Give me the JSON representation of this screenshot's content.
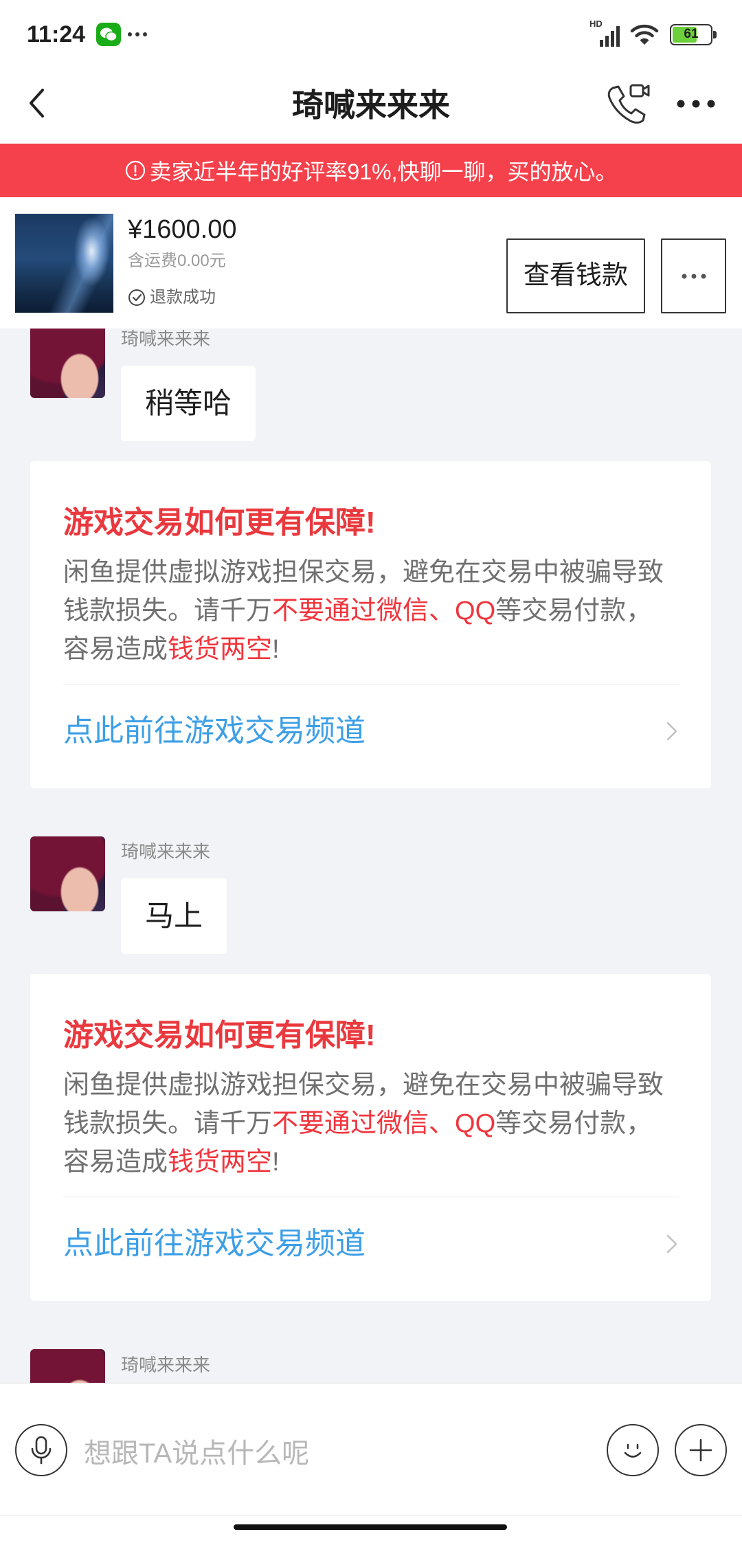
{
  "status_bar": {
    "time": "11:24",
    "network_label": "HD",
    "battery_level": "61",
    "icons": [
      "wechat-icon",
      "more-notifications-icon",
      "signal-icon",
      "wifi-icon",
      "battery-icon"
    ]
  },
  "header": {
    "title": "琦喊来来来",
    "icons": [
      "back-icon",
      "phone-video-icon",
      "more-icon"
    ]
  },
  "banner": {
    "icon": "info-icon",
    "text": "卖家近半年的好评率91%,快聊一聊，买的放心。"
  },
  "product": {
    "price": "¥1600.00",
    "shipping": "含运费0.00元",
    "status": "退款成功",
    "status_icon": "check-circle-icon",
    "view_button": "查看钱款",
    "more_icon": "more-dots-icon"
  },
  "messages": [
    {
      "sender": "琦喊来来来",
      "text": "稍等哈"
    },
    {
      "sender": "琦喊来来来",
      "text": "马上"
    },
    {
      "sender": "琦喊来来来"
    }
  ],
  "notice_cards": [
    {
      "title": "游戏交易如何更有保障!",
      "lines": [
        [
          {
            "text": "闲鱼提供虚拟游戏担保交易，避免在交易中被骗导致",
            "highlight": false
          }
        ],
        [
          {
            "text": "钱款损失。请千万",
            "highlight": false
          },
          {
            "text": "不要通过微信、QQ",
            "highlight": true
          },
          {
            "text": "等交易付款，",
            "highlight": false
          }
        ],
        [
          {
            "text": "容易造成",
            "highlight": false
          },
          {
            "text": "钱货两空",
            "highlight": true
          },
          {
            "text": "!",
            "highlight": false
          }
        ]
      ],
      "link": "点此前往游戏交易频道"
    },
    {
      "title": "游戏交易如何更有保障!",
      "lines": [
        [
          {
            "text": "闲鱼提供虚拟游戏担保交易，避免在交易中被骗导致",
            "highlight": false
          }
        ],
        [
          {
            "text": "钱款损失。请千万",
            "highlight": false
          },
          {
            "text": "不要通过微信、QQ",
            "highlight": true
          },
          {
            "text": "等交易付款，",
            "highlight": false
          }
        ],
        [
          {
            "text": "容易造成",
            "highlight": false
          },
          {
            "text": "钱货两空",
            "highlight": true
          },
          {
            "text": "!",
            "highlight": false
          }
        ]
      ],
      "link": "点此前往游戏交易频道"
    }
  ],
  "input": {
    "placeholder": "想跟TA说点什么呢",
    "icons": [
      "voice-icon",
      "emoji-icon",
      "plus-icon"
    ]
  },
  "colors": {
    "banner_bg": "#f5414b",
    "chat_bg": "#f2f3f7",
    "notice_title_red": "#e9393e",
    "warning_red": "#f0353d",
    "link_blue": "#3d9fe6",
    "battery_green": "#6ccf3c",
    "wechat_green": "#1aad19"
  }
}
